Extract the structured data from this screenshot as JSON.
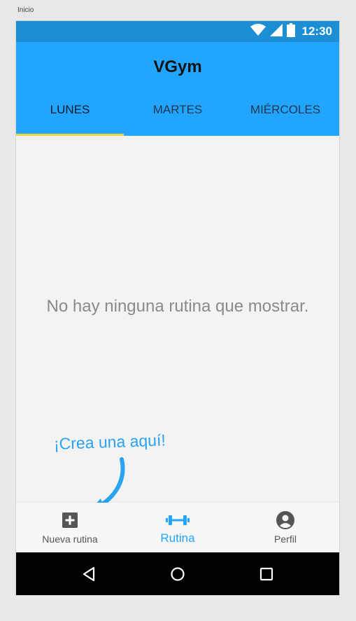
{
  "page_label": "Inicio",
  "status_bar": {
    "time": "12:30",
    "icons": [
      "wifi-icon",
      "signal-icon",
      "battery-icon"
    ]
  },
  "app_bar": {
    "title": "VGym",
    "tabs": [
      {
        "label": "LUNES",
        "active": true
      },
      {
        "label": "MARTES",
        "active": false
      },
      {
        "label": "MIÉRCOLES",
        "active": false
      }
    ]
  },
  "content": {
    "empty_message": "No hay ninguna rutina que mostrar.",
    "hint": "¡Crea una aquí!"
  },
  "bottom_nav": {
    "items": [
      {
        "label": "Nueva rutina",
        "icon": "add-box-icon",
        "active": false
      },
      {
        "label": "Rutina",
        "icon": "dumbbell-icon",
        "active": true
      },
      {
        "label": "Perfil",
        "icon": "account-circle-icon",
        "active": false
      }
    ]
  },
  "system_nav": {
    "buttons": [
      "back-icon",
      "home-icon",
      "recents-icon"
    ]
  },
  "colors": {
    "status_bar": "#1c8fd4",
    "app_bar": "#22a5ff",
    "tab_indicator": "#f2d43a",
    "accent": "#22a5ff",
    "hint": "#2ba3f0",
    "background": "#f3f3f3"
  }
}
